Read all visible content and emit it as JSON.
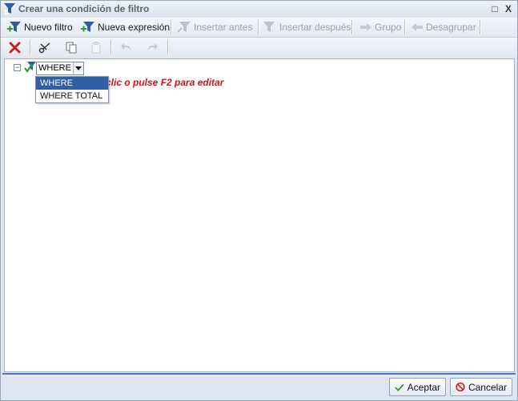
{
  "window": {
    "title": "Crear una condición de filtro",
    "maximize_glyph": "□",
    "close_glyph": "X"
  },
  "toolbar1": {
    "items": [
      {
        "label": "Nuevo filtro",
        "icon": "funnel-add-icon",
        "enabled": true
      },
      {
        "label": "Nueva expresión",
        "icon": "funnel-add-icon",
        "enabled": true
      },
      {
        "label": "Insertar antes",
        "icon": "funnel-insert-before-icon",
        "enabled": false
      },
      {
        "label": "Insertar después",
        "icon": "funnel-insert-after-icon",
        "enabled": false
      },
      {
        "label": "Grupo",
        "icon": "arrow-right-icon",
        "enabled": false
      },
      {
        "label": "Desagrupar",
        "icon": "arrow-left-icon",
        "enabled": false
      }
    ]
  },
  "toolbar2": {
    "items": [
      {
        "icon": "delete-x-icon",
        "enabled": true
      },
      {
        "icon": "cut-scissors-icon",
        "enabled": true
      },
      {
        "icon": "copy-icon",
        "enabled": true
      },
      {
        "icon": "paste-icon",
        "enabled": false
      },
      {
        "icon": "undo-icon",
        "enabled": false
      },
      {
        "icon": "redo-icon",
        "enabled": false
      }
    ]
  },
  "editor": {
    "tree_toggle": "−",
    "combo_value": "WHERE",
    "hint_text": "clic o pulse F2 para editar",
    "dropdown_options": [
      {
        "label": "WHERE",
        "selected": true
      },
      {
        "label": "WHERE TOTAL",
        "selected": false
      }
    ]
  },
  "footer": {
    "accept_label": "Aceptar",
    "cancel_label": "Cancelar"
  },
  "colors": {
    "hint": "#d6121a",
    "selection": "#2f5ea2",
    "accent_line": "#4a78c2"
  }
}
